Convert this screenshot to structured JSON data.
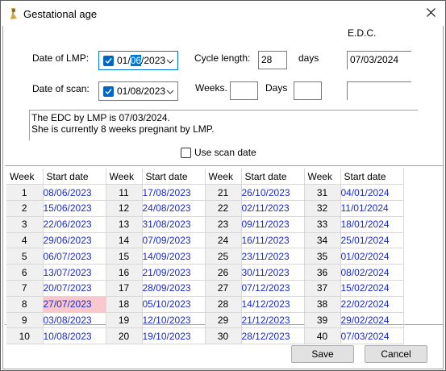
{
  "window": {
    "title": "Gestational age"
  },
  "edc_label": "E.D.C.",
  "lmp": {
    "label": "Date of LMP:",
    "value_pre": "01/",
    "value_sel": "06",
    "value_post": "/2023"
  },
  "scan": {
    "label": "Date of scan:",
    "value": "01/08/2023"
  },
  "cycle": {
    "label": "Cycle length:",
    "value": "28",
    "unit": "days"
  },
  "weeks_label": "Weeks.",
  "days_label": "Days",
  "edc_value": "07/03/2024",
  "summary": {
    "line1": "The EDC by LMP is 07/03/2024.",
    "line2": "She is currently 8 weeks pregnant by LMP."
  },
  "use_scan_label": "Use scan date",
  "grid_headers": {
    "week": "Week",
    "start": "Start date"
  },
  "highlight_color": "#f8c8cc",
  "weeks": [
    [
      "1",
      "08/06/2023",
      "11",
      "17/08/2023",
      "21",
      "26/10/2023",
      "31",
      "04/01/2024"
    ],
    [
      "2",
      "15/06/2023",
      "12",
      "24/08/2023",
      "22",
      "02/11/2023",
      "32",
      "11/01/2024"
    ],
    [
      "3",
      "22/06/2023",
      "13",
      "31/08/2023",
      "23",
      "09/11/2023",
      "33",
      "18/01/2024"
    ],
    [
      "4",
      "29/06/2023",
      "14",
      "07/09/2023",
      "24",
      "16/11/2023",
      "34",
      "25/01/2024"
    ],
    [
      "5",
      "06/07/2023",
      "15",
      "14/09/2023",
      "25",
      "23/11/2023",
      "35",
      "01/02/2024"
    ],
    [
      "6",
      "13/07/2023",
      "16",
      "21/09/2023",
      "26",
      "30/11/2023",
      "36",
      "08/02/2024"
    ],
    [
      "7",
      "20/07/2023",
      "17",
      "28/09/2023",
      "27",
      "07/12/2023",
      "37",
      "15/02/2024"
    ],
    [
      "8",
      "27/07/2023",
      "18",
      "05/10/2023",
      "28",
      "14/12/2023",
      "38",
      "22/02/2024"
    ],
    [
      "9",
      "03/08/2023",
      "19",
      "12/10/2023",
      "29",
      "21/12/2023",
      "39",
      "29/02/2024"
    ],
    [
      "10",
      "10/08/2023",
      "20",
      "19/10/2023",
      "30",
      "28/12/2023",
      "40",
      "07/03/2024"
    ]
  ],
  "buttons": {
    "save": "Save",
    "cancel": "Cancel"
  }
}
